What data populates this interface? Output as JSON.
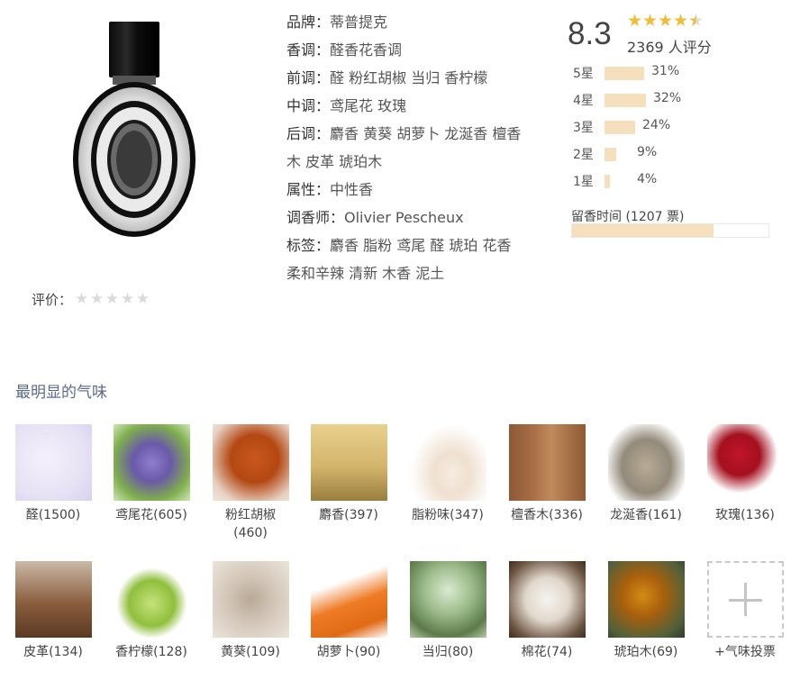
{
  "product": {
    "image_alt": "Diptyque Fleur de Peau bottle",
    "rating_label": "评价：",
    "rating_stars": 0
  },
  "info": [
    {
      "key": "品牌：",
      "value": "蒂普提克"
    },
    {
      "key": "香调：",
      "value": "醛香花香调"
    },
    {
      "key": "前调：",
      "value": "醛 粉红胡椒 当归 香柠檬"
    },
    {
      "key": "中调：",
      "value": "鸢尾花 玫瑰"
    },
    {
      "key": "后调：",
      "value": "麝香 黄葵 胡萝卜 龙涎香 檀香"
    },
    {
      "key": "",
      "value": "木 皮革 琥珀木"
    },
    {
      "key": "属性：",
      "value": "中性香"
    },
    {
      "key": "调香师：",
      "value": "Olivier Pescheux"
    },
    {
      "key": "标签：",
      "value": "麝香 脂粉 鸢尾 醛 琥珀 花香"
    },
    {
      "key": "",
      "value": "柔和辛辣 清新 木香 泥土"
    }
  ],
  "score": {
    "value": "8.3",
    "stars": 4.25,
    "count_text": "2369 人评分",
    "distribution": [
      {
        "label": "5星",
        "pct_text": "31%",
        "pct": 31
      },
      {
        "label": "4星",
        "pct_text": "32%",
        "pct": 32
      },
      {
        "label": "3星",
        "pct_text": "24%",
        "pct": 24
      },
      {
        "label": "2星",
        "pct_text": "9%",
        "pct": 9
      },
      {
        "label": "1星",
        "pct_text": "4%",
        "pct": 4
      }
    ],
    "longevity_label": "留香时间 (1207 票)",
    "longevity_fraction": 0.72
  },
  "notes_section": {
    "title": "最明显的气味",
    "notes": [
      {
        "name": "醛",
        "count": "(1500)",
        "pic": "aldehyde"
      },
      {
        "name": "鸢尾花",
        "count": "(605)",
        "pic": "iris"
      },
      {
        "name": "粉红胡椒",
        "count": "(460)",
        "pic": "pepper"
      },
      {
        "name": "麝香",
        "count": "(397)",
        "pic": "musk"
      },
      {
        "name": "脂粉味",
        "count": "(347)",
        "pic": "powder"
      },
      {
        "name": "檀香木",
        "count": "(336)",
        "pic": "sandal"
      },
      {
        "name": "龙涎香",
        "count": "(161)",
        "pic": "amber"
      },
      {
        "name": "玫瑰",
        "count": "(136)",
        "pic": "rose"
      },
      {
        "name": "皮革",
        "count": "(134)",
        "pic": "leather"
      },
      {
        "name": "香柠檬",
        "count": "(128)",
        "pic": "lime"
      },
      {
        "name": "黄葵",
        "count": "(109)",
        "pic": "ambrette"
      },
      {
        "name": "胡萝卜",
        "count": "(90)",
        "pic": "carrot"
      },
      {
        "name": "当归",
        "count": "(80)",
        "pic": "angelica"
      },
      {
        "name": "棉花",
        "count": "(74)",
        "pic": "cotton"
      },
      {
        "name": "琥珀木",
        "count": "(69)",
        "pic": "amberwood"
      }
    ],
    "add_vote_label": "+气味投票"
  }
}
